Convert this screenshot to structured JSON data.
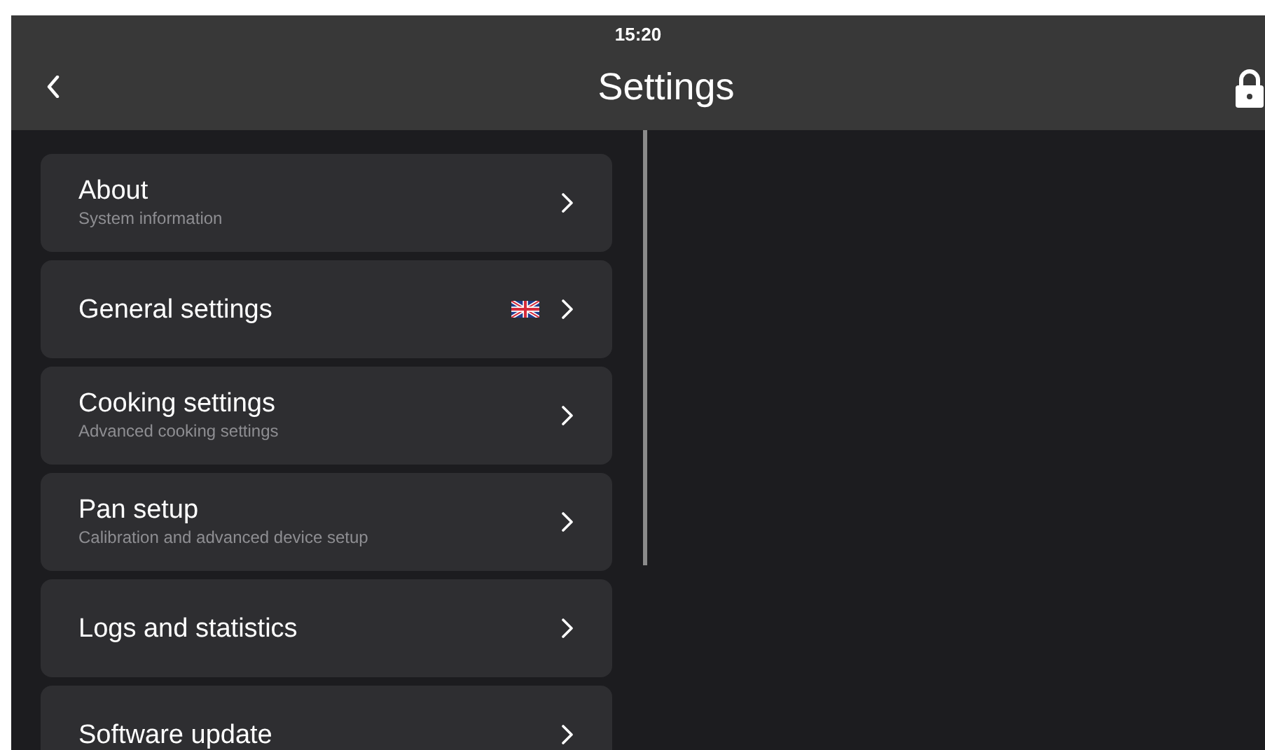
{
  "status_bar": {
    "time": "15:20"
  },
  "header": {
    "title": "Settings"
  },
  "menu": [
    {
      "title": "About",
      "subtitle": "System information",
      "language_flag": false
    },
    {
      "title": "General settings",
      "language_flag": true
    },
    {
      "title": "Cooking settings",
      "subtitle": "Advanced cooking settings",
      "language_flag": false
    },
    {
      "title": "Pan setup",
      "subtitle": "Calibration and advanced device setup",
      "language_flag": false
    },
    {
      "title": "Logs and statistics",
      "language_flag": false
    },
    {
      "title": "Software update",
      "language_flag": false
    }
  ]
}
